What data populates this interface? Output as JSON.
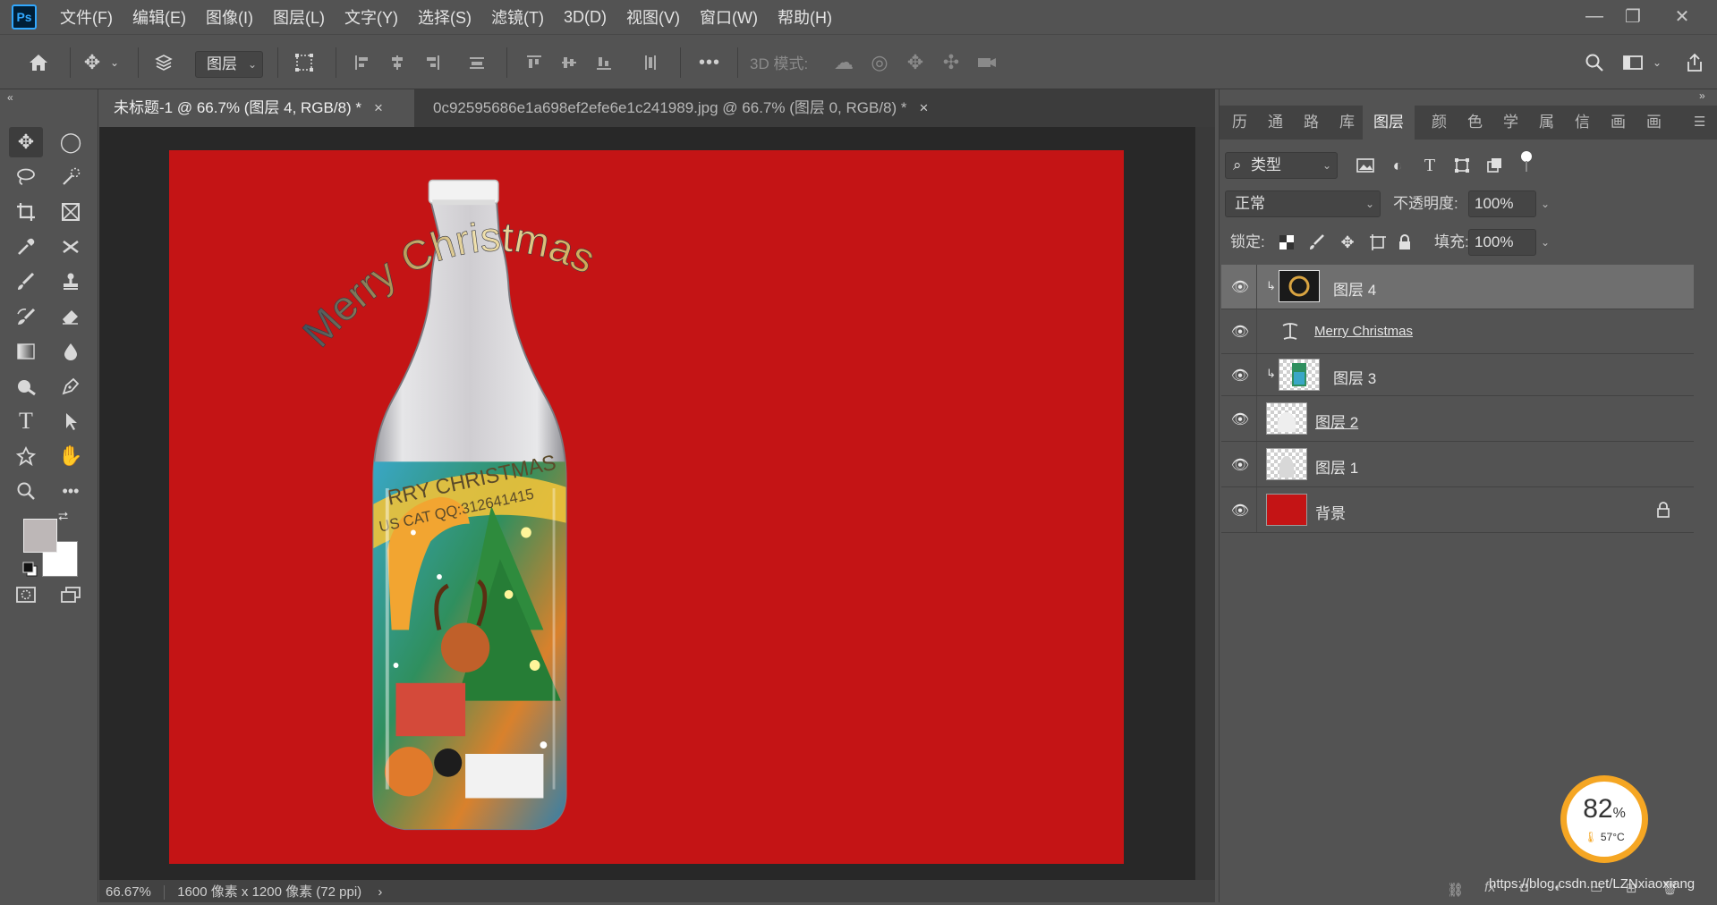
{
  "menubar": {
    "logo": "Ps",
    "items": [
      "文件(F)",
      "编辑(E)",
      "图像(I)",
      "图层(L)",
      "文字(Y)",
      "选择(S)",
      "滤镜(T)",
      "3D(D)",
      "视图(V)",
      "窗口(W)",
      "帮助(H)"
    ]
  },
  "options": {
    "layer_select": "图层",
    "threed_mode": "3D 模式:"
  },
  "tabs": [
    {
      "title": "未标题-1 @ 66.7% (图层 4, RGB/8) *",
      "close": "×"
    },
    {
      "title": "0c92595686e1a698ef2efe6e1c241989.jpg @ 66.7% (图层 0, RGB/8) *",
      "close": "×"
    }
  ],
  "canvas": {
    "arc_text": "Merry Christmas",
    "bottle_text_1": "RRY CHRISTMAS",
    "bottle_text_2": "US CAT  QQ:312641415",
    "background_color": "#c41415"
  },
  "status": {
    "zoom": "66.67%",
    "doc_info": "1600 像素 x 1200 像素 (72 ppi)",
    "arrow": "›"
  },
  "panel": {
    "tabs": [
      "历",
      "通",
      "路",
      "库",
      "图层",
      "颜",
      "色",
      "学",
      "属",
      "信",
      "画",
      "画"
    ],
    "kind_filter": "类型",
    "blend_mode": "正常",
    "opacity_label": "不透明度:",
    "opacity_value": "100%",
    "lock_label": "锁定:",
    "fill_label": "填充:",
    "fill_value": "100%"
  },
  "layers": [
    {
      "name": "图层 4",
      "selected": true,
      "clipped": true
    },
    {
      "name": "Merry Christmas",
      "type": "text"
    },
    {
      "name": "图层 3",
      "clipped": true
    },
    {
      "name": "图层 2"
    },
    {
      "name": "图层 1"
    },
    {
      "name": "背景",
      "locked": true
    }
  ],
  "perf": {
    "percent": "82",
    "percent_sign": "%",
    "temp": "57°C"
  },
  "watermark": "https://blog.csdn.net/LZNxiaoxiang",
  "colors": {
    "accent_orange": "#f5a623",
    "canvas_red": "#c41415",
    "ps_blue": "#31a8ff"
  }
}
